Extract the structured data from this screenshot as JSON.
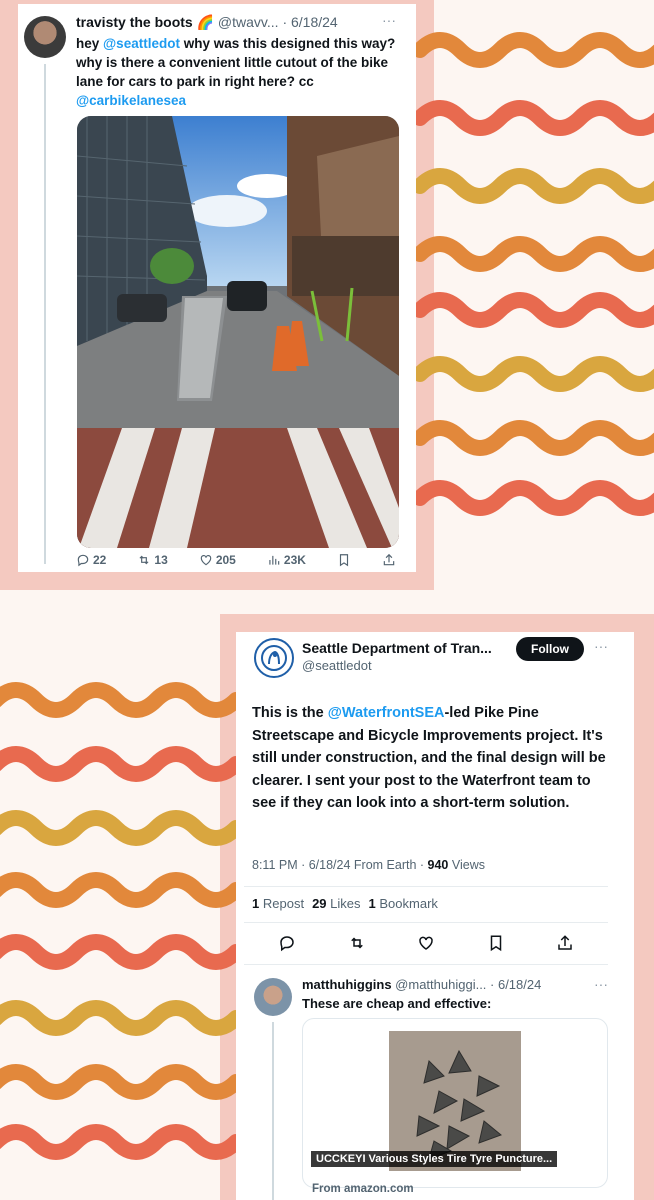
{
  "colors": {
    "wave_orange": "#e2883b",
    "wave_coral": "#e86a4f",
    "wave_gold": "#d9a63f",
    "pink_frame": "#f4c9c0",
    "link": "#1d9bf0"
  },
  "tweet1": {
    "display_name": "travisty the boots",
    "emoji": "🌈",
    "handle_date": "@twavv... · 6/18/24",
    "more": "···",
    "body_prefix": "hey ",
    "mention1": "@seattledot",
    "body_middle": " why was this designed this way? why is there a convenient little cutout of the bike lane for cars to park in right here? cc ",
    "mention2": "@carbikelanesea",
    "actions": {
      "replies": "22",
      "reposts": "13",
      "likes": "205",
      "views": "23K"
    },
    "icons": [
      "reply-icon",
      "repost-icon",
      "like-icon",
      "views-icon",
      "bookmark-icon",
      "share-icon"
    ]
  },
  "tweet2": {
    "name": "Seattle Department of Tran...",
    "handle": "@seattledot",
    "follow_label": "Follow",
    "more": "···",
    "body_prefix": "This is the ",
    "mention": "@WaterfrontSEA",
    "body_rest": "-led Pike Pine Streetscape and Bicycle Improvements project. It's still under construction, and the final design will be clearer. I sent your post to the Waterfront team to see if they can look into a short-term solution.",
    "meta_time": "8:11 PM · 6/18/24 From Earth · ",
    "meta_views_count": "940",
    "meta_views_label": " Views",
    "stats": [
      {
        "count": "1",
        "label": "Repost"
      },
      {
        "count": "29",
        "label": "Likes"
      },
      {
        "count": "1",
        "label": "Bookmark"
      }
    ]
  },
  "reply": {
    "display_name": "matthuhiggins",
    "handle_date": "@matthuhiggi... · 6/18/24",
    "more": "···",
    "text": "These are cheap and effective:",
    "caption": "UCCKEYI Various Styles Tire Tyre Puncture...",
    "source": "From amazon.com"
  }
}
